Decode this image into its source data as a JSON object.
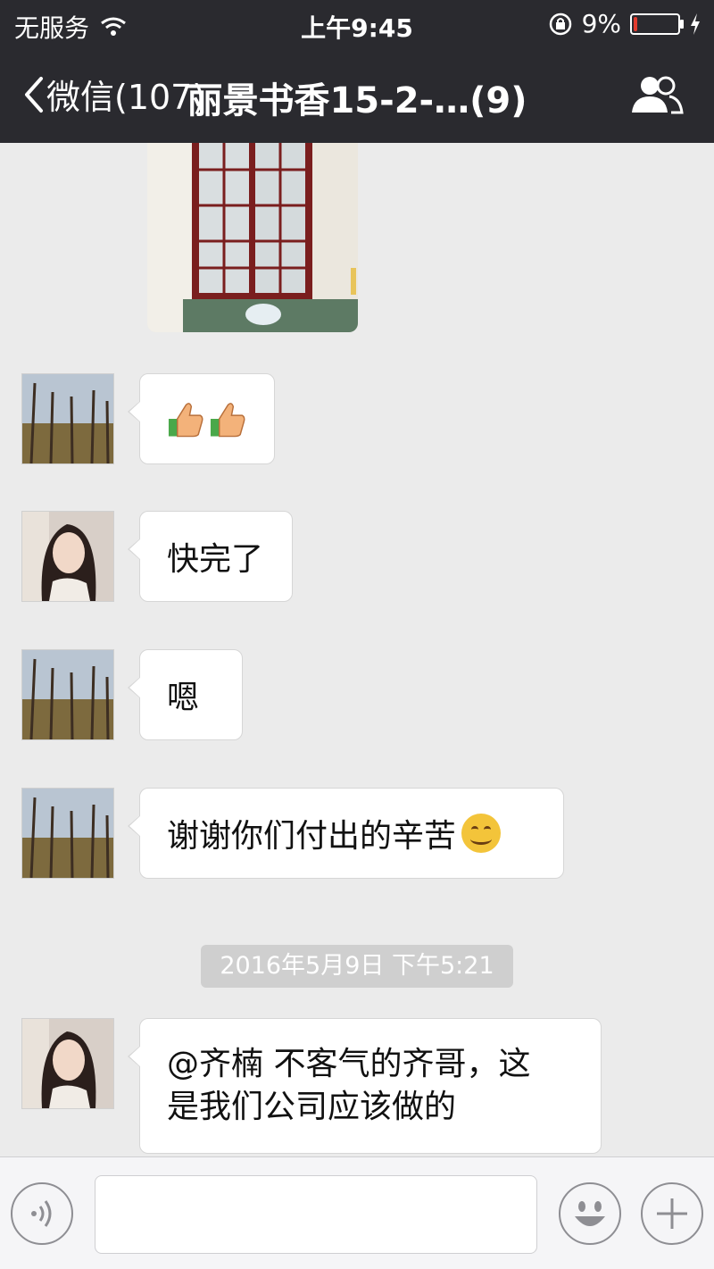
{
  "status_bar": {
    "carrier": "无服务",
    "time": "上午9:45",
    "battery_percent": "9%",
    "battery_level": 0.09
  },
  "nav": {
    "back_label": "微信(107)",
    "title": "丽景书香15-2-…(9)"
  },
  "messages": [
    {
      "type": "thumbs",
      "sender": "avatar-trees"
    },
    {
      "type": "text",
      "sender": "avatar-woman",
      "text": "快完了"
    },
    {
      "type": "text",
      "sender": "avatar-trees",
      "text": "嗯"
    },
    {
      "type": "text_emoji",
      "sender": "avatar-trees",
      "text": "谢谢你们付出的辛苦"
    },
    {
      "type": "text",
      "sender": "avatar-woman",
      "line1": "@齐楠 不客气的齐哥，这",
      "line2": "是我们公司应该做的"
    }
  ],
  "timestamp": "2016年5月9日 下午5:21",
  "colors": {
    "header_bg": "#2a2a2f",
    "chat_bg": "#ebebeb",
    "bubble_bg": "#ffffff",
    "battery_low": "#e23b2e"
  }
}
